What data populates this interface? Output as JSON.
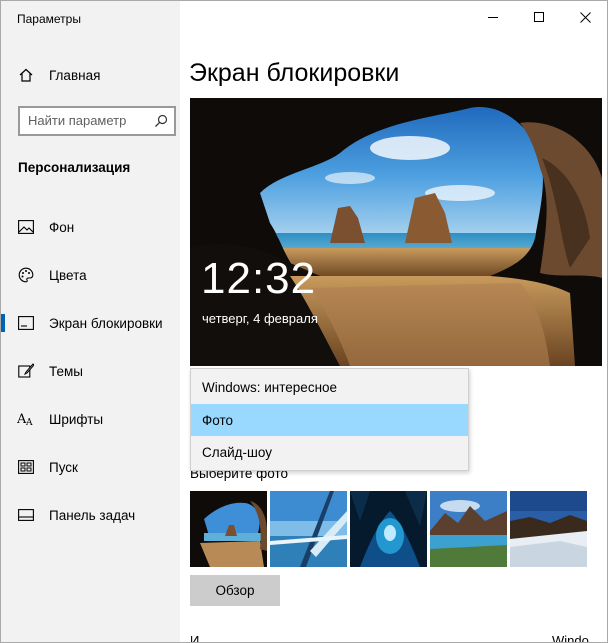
{
  "window": {
    "title": "Параметры"
  },
  "sidebar": {
    "home_label": "Главная",
    "search_placeholder": "Найти параметр",
    "section_title": "Персонализация",
    "items": [
      {
        "label": "Фон",
        "icon": "image-icon"
      },
      {
        "label": "Цвета",
        "icon": "palette-icon"
      },
      {
        "label": "Экран блокировки",
        "icon": "lock-screen-icon",
        "active": true
      },
      {
        "label": "Темы",
        "icon": "brush-icon"
      },
      {
        "label": "Шрифты",
        "icon": "font-icon"
      },
      {
        "label": "Пуск",
        "icon": "start-icon"
      },
      {
        "label": "Панель задач",
        "icon": "taskbar-icon"
      }
    ]
  },
  "main": {
    "page_title": "Экран блокировки",
    "preview": {
      "time": "12:32",
      "date": "четверг, 4 февраля"
    },
    "background_dropdown": {
      "options": [
        "Windows: интересное",
        "Фото",
        "Слайд-шоу"
      ],
      "selected": "Фото"
    },
    "choose_photo_label": "Выберите фото",
    "browse_label": "Обзор",
    "cut_text_left": "И",
    "cut_text_right": "Windo"
  },
  "colors": {
    "accent": "#0063b1",
    "selection": "#99d9ff",
    "sidebar_bg": "#f2f2f2",
    "button_bg": "#cccccc"
  }
}
